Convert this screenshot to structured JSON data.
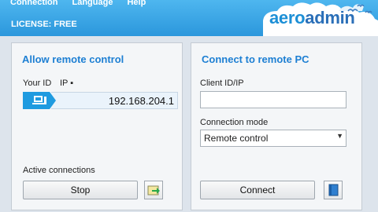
{
  "menu": [
    "Connection",
    "Language",
    "Help"
  ],
  "license": "LICENSE: FREE",
  "logo": {
    "aero": "aero",
    "admin": "admin"
  },
  "left_panel": {
    "title": "Allow remote control",
    "your_id_label": "Your ID",
    "ip_label": "IP ▪",
    "ip_value": "192.168.204.1",
    "active_label": "Active connections",
    "stop_label": "Stop"
  },
  "right_panel": {
    "title": "Connect to remote PC",
    "client_label": "Client ID/IP",
    "client_value": "",
    "mode_label": "Connection mode",
    "mode_value": "Remote control",
    "connect_label": "Connect"
  },
  "colors": {
    "header": "#2b97dc",
    "title": "#1d7fd3",
    "id_tag": "#1f9be0"
  },
  "icons": [
    "computer-icon",
    "transfer-icon",
    "phonebook-icon",
    "chevron-down-icon"
  ]
}
